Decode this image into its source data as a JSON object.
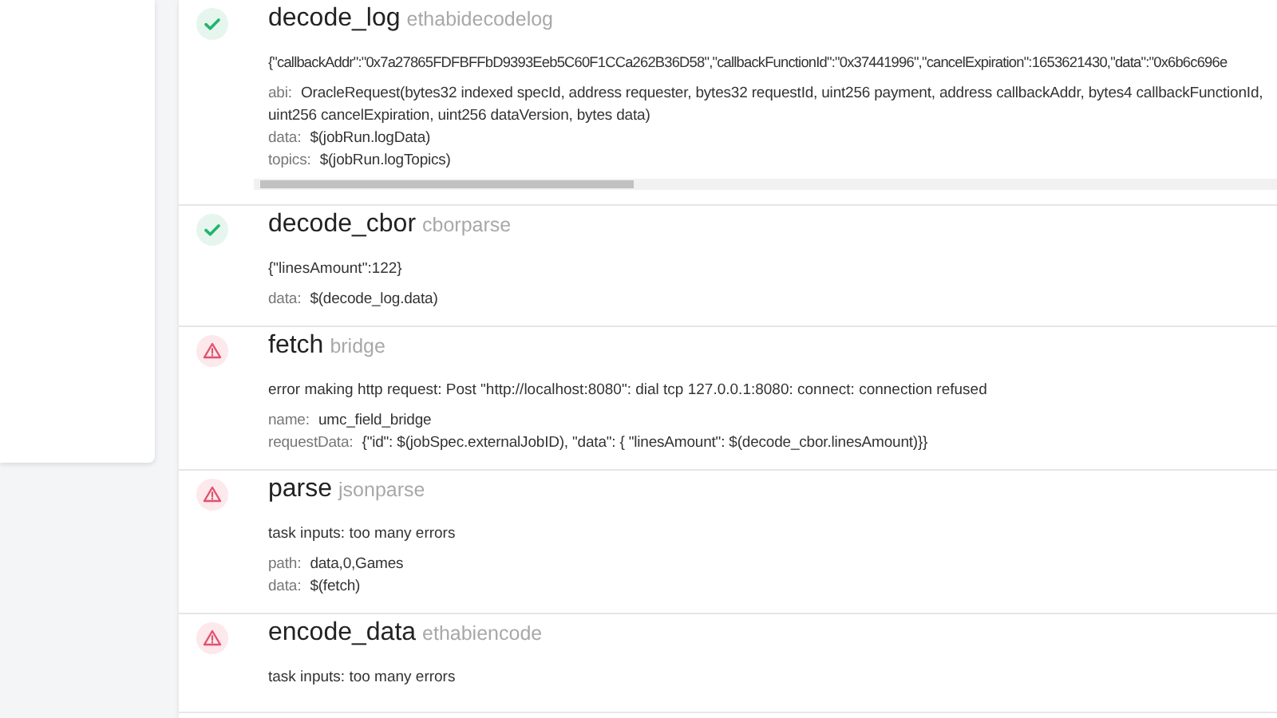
{
  "tasks": [
    {
      "name": "decode_log",
      "type": "ethabidecodelog",
      "kind": "check",
      "result": "{\"callbackAddr\":\"0x7a27865FDFBFFbD9393Eeb5C60F1CCa262B36D58\",\"callbackFunctionId\":\"0x37441996\",\"cancelExpiration\":1653621430,\"data\":\"0x6b6c696e",
      "scrollable": true,
      "params": [
        {
          "key": "abi:",
          "value": "OracleRequest(bytes32 indexed specId, address requester, bytes32 requestId, uint256 payment, address callbackAddr, bytes4 callbackFunctionId, uint256 cancelExpiration, uint256 dataVersion, bytes data)"
        },
        {
          "key": "data:",
          "value": "$(jobRun.logData)"
        },
        {
          "key": "topics:",
          "value": "$(jobRun.logTopics)"
        }
      ]
    },
    {
      "name": "decode_cbor",
      "type": "cborparse",
      "kind": "check",
      "result": "{\"linesAmount\":122}",
      "scrollable": false,
      "params": [
        {
          "key": "data:",
          "value": "$(decode_log.data)"
        }
      ]
    },
    {
      "name": "fetch",
      "type": "bridge",
      "kind": "warning",
      "result": "error making http request: Post \"http://localhost:8080\": dial tcp 127.0.0.1:8080: connect: connection refused",
      "scrollable": false,
      "params": [
        {
          "key": "name:",
          "value": "umc_field_bridge"
        },
        {
          "key": "requestData:",
          "value": "{\"id\": $(jobSpec.externalJobID), \"data\": { \"linesAmount\": $(decode_cbor.linesAmount)}}"
        }
      ]
    },
    {
      "name": "parse",
      "type": "jsonparse",
      "kind": "warning",
      "result": "task inputs: too many errors",
      "scrollable": false,
      "params": [
        {
          "key": "path:",
          "value": "data,0,Games"
        },
        {
          "key": "data:",
          "value": "$(fetch)"
        }
      ]
    },
    {
      "name": "encode_data",
      "type": "ethabiencode",
      "kind": "warning",
      "result": "task inputs: too many errors",
      "scrollable": false
    }
  ]
}
